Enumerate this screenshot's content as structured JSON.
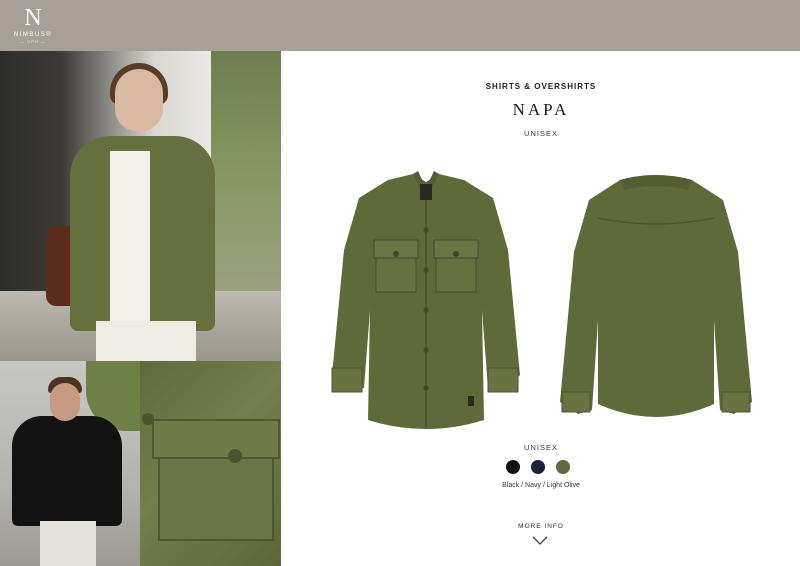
{
  "brand": {
    "mark": "N",
    "name": "NIMBUS®",
    "sub": "— CPH —"
  },
  "product": {
    "category": "SHIRTS & OVERSHIRTS",
    "name": "NAPA",
    "fit_top": "UNISEX",
    "fit_bottom": "UNISEX",
    "colors_label": "Black / Navy / Light Olive",
    "swatches": [
      {
        "name": "Black",
        "color": "#111111"
      },
      {
        "name": "Navy",
        "color": "#1b2438"
      },
      {
        "name": "Light Olive",
        "color": "#5e6b3a"
      }
    ]
  },
  "footer": {
    "more_info": "MORE INFO"
  },
  "colors": {
    "header_bg": "#a7a097",
    "olive": "#5f6b3b"
  },
  "icons": {
    "more_info": "chevron-down-icon"
  }
}
